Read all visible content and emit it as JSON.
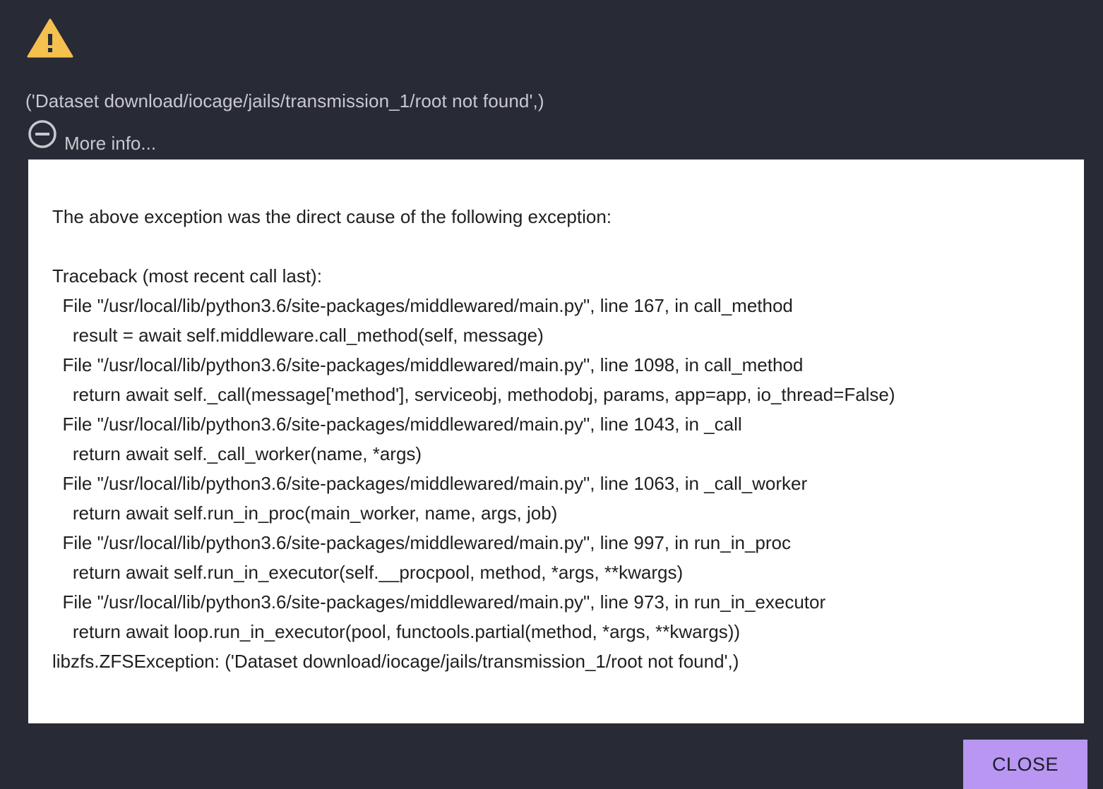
{
  "dialog": {
    "icon": "warning-icon",
    "message": "('Dataset download/iocage/jails/transmission_1/root not found',)",
    "more_info_icon": "minus-circle-icon",
    "more_info_label": "More info...",
    "traceback_text": "\"\"\"\n\nThe above exception was the direct cause of the following exception:\n\nTraceback (most recent call last):\n  File \"/usr/local/lib/python3.6/site-packages/middlewared/main.py\", line 167, in call_method\n    result = await self.middleware.call_method(self, message)\n  File \"/usr/local/lib/python3.6/site-packages/middlewared/main.py\", line 1098, in call_method\n    return await self._call(message['method'], serviceobj, methodobj, params, app=app, io_thread=False)\n  File \"/usr/local/lib/python3.6/site-packages/middlewared/main.py\", line 1043, in _call\n    return await self._call_worker(name, *args)\n  File \"/usr/local/lib/python3.6/site-packages/middlewared/main.py\", line 1063, in _call_worker\n    return await self.run_in_proc(main_worker, name, args, job)\n  File \"/usr/local/lib/python3.6/site-packages/middlewared/main.py\", line 997, in run_in_proc\n    return await self.run_in_executor(self.__procpool, method, *args, **kwargs)\n  File \"/usr/local/lib/python3.6/site-packages/middlewared/main.py\", line 973, in run_in_executor\n    return await loop.run_in_executor(pool, functools.partial(method, *args, **kwargs))\nlibzfs.ZFSException: ('Dataset download/iocage/jails/transmission_1/root not found',)",
    "close_label": "CLOSE"
  },
  "colors": {
    "background": "#282a36",
    "warning": "#f4c04e",
    "close_button": "#b896f2"
  }
}
